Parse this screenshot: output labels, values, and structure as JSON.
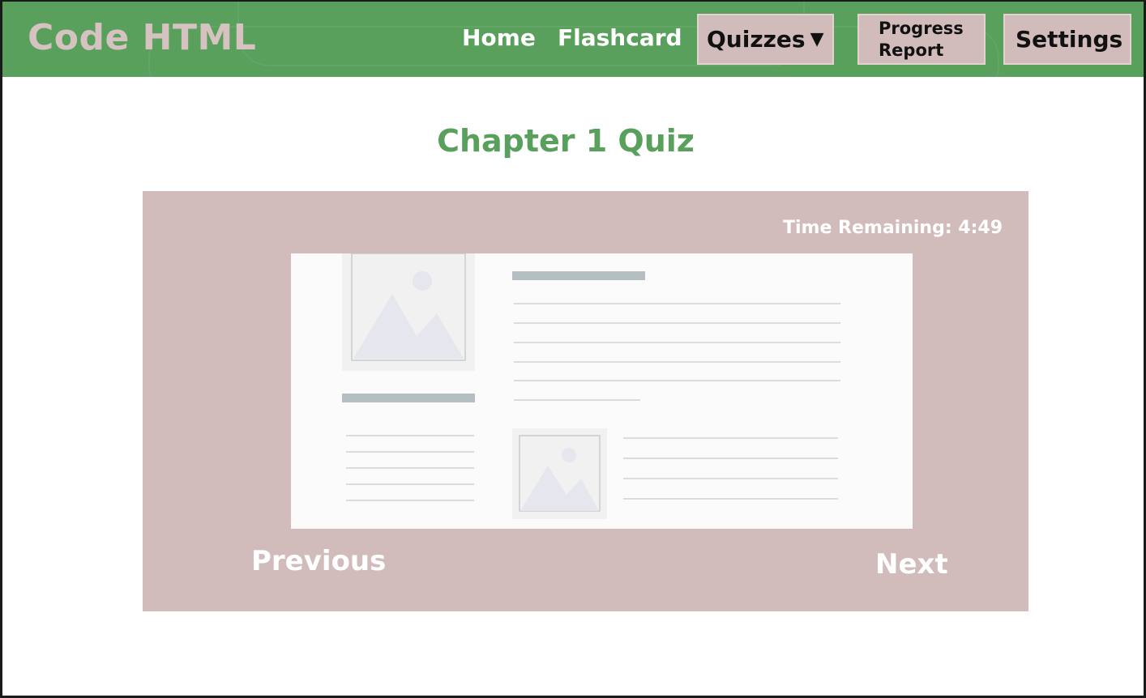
{
  "header": {
    "brand": "Code HTML",
    "nav": {
      "home": "Home",
      "flashcard": "Flashcard",
      "quizzes": "Quizzes",
      "quizzes_caret": "▼",
      "progress_line1": "Progress",
      "progress_line2": "Report",
      "settings": "Settings"
    }
  },
  "main": {
    "title": "Chapter 1 Quiz",
    "timer": "Time Remaining: 4:49",
    "previous": "Previous",
    "next": "Next"
  },
  "colors": {
    "header_bg": "#59a05c",
    "accent_green": "#59a05c",
    "panel_bg": "#d2bcbb",
    "brand_text": "#d6c2c0"
  },
  "icons": [
    "image-placeholder-icon",
    "dropdown-caret-icon"
  ]
}
